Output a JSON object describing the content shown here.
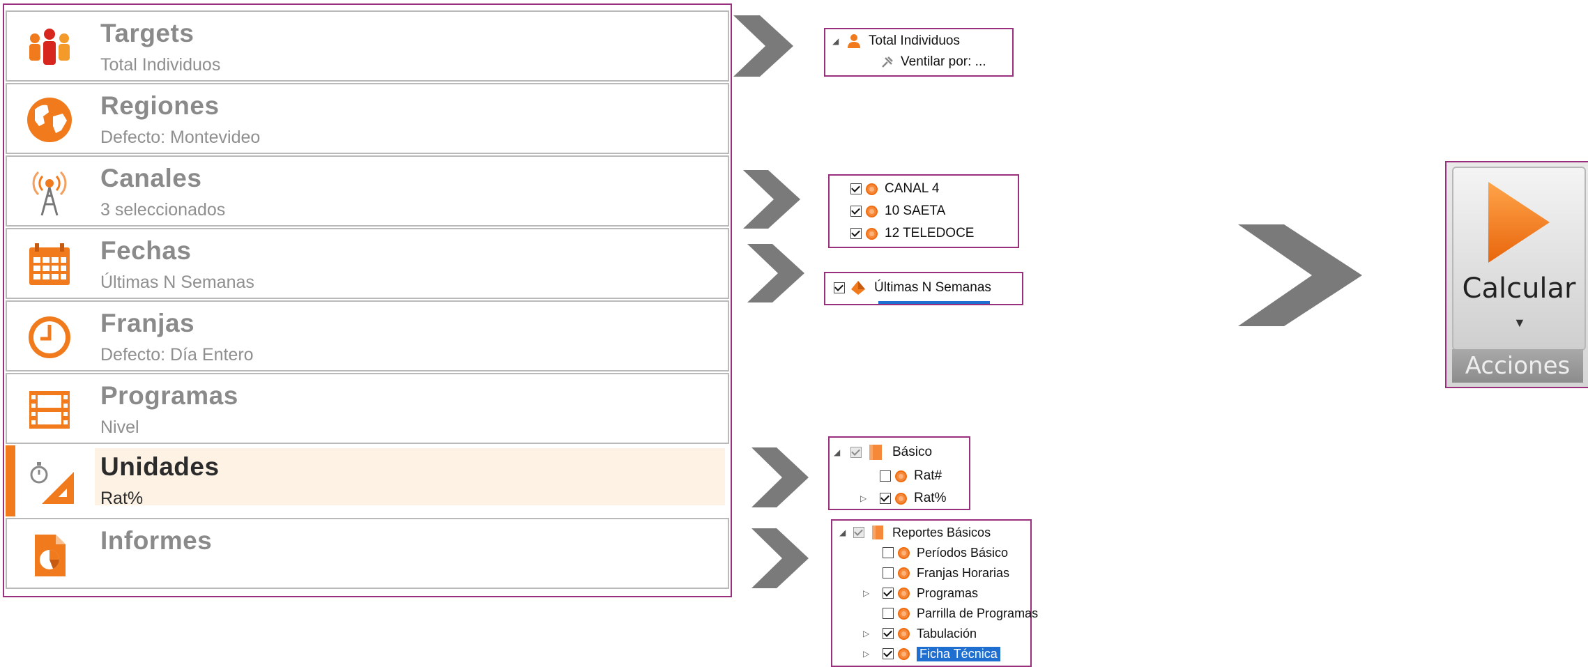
{
  "nav": {
    "items": [
      {
        "title": "Targets",
        "subtitle": "Total Individuos",
        "icon": "people-icon"
      },
      {
        "title": "Regiones",
        "subtitle": "Defecto: Montevideo",
        "icon": "globe-icon"
      },
      {
        "title": "Canales",
        "subtitle": "3 seleccionados",
        "icon": "antenna-icon"
      },
      {
        "title": "Fechas",
        "subtitle": "Últimas N Semanas",
        "icon": "calendar-icon"
      },
      {
        "title": "Franjas",
        "subtitle": "Defecto: Día Entero",
        "icon": "clock-icon"
      },
      {
        "title": "Programas",
        "subtitle": "Nivel",
        "icon": "film-icon"
      },
      {
        "title": "Unidades",
        "subtitle": "Rat%",
        "icon": "stopwatch-ruler-icon",
        "selected": true
      },
      {
        "title": "Informes",
        "subtitle": "",
        "icon": "report-pie-icon"
      }
    ]
  },
  "targets_tree": {
    "root": "Total Individuos",
    "child": "Ventilar por: ..."
  },
  "canales_tree": {
    "items": [
      {
        "label": "CANAL 4",
        "checked": true
      },
      {
        "label": "10 SAETA",
        "checked": true
      },
      {
        "label": "12 TELEDOCE",
        "checked": true
      }
    ]
  },
  "fechas_tree": {
    "item": "Últimas N Semanas"
  },
  "unidades_tree": {
    "root": "Básico",
    "items": [
      {
        "label": "Rat#",
        "checked": false
      },
      {
        "label": "Rat%",
        "checked": true
      }
    ]
  },
  "informes_tree": {
    "root": "Reportes Básicos",
    "items": [
      {
        "label": "Períodos Básico",
        "checked": false
      },
      {
        "label": "Franjas Horarias",
        "checked": false
      },
      {
        "label": "Programas",
        "checked": true
      },
      {
        "label": "Parrilla de Programas",
        "checked": false
      },
      {
        "label": "Tabulación",
        "checked": true
      },
      {
        "label": "Ficha Técnica",
        "checked": true,
        "selected": true
      }
    ]
  },
  "calc": {
    "label": "Calcular",
    "group": "Acciones"
  },
  "colors": {
    "accent": "#f07a1c",
    "frame": "#9a2f7e",
    "chevron": "#7a7a7a"
  }
}
